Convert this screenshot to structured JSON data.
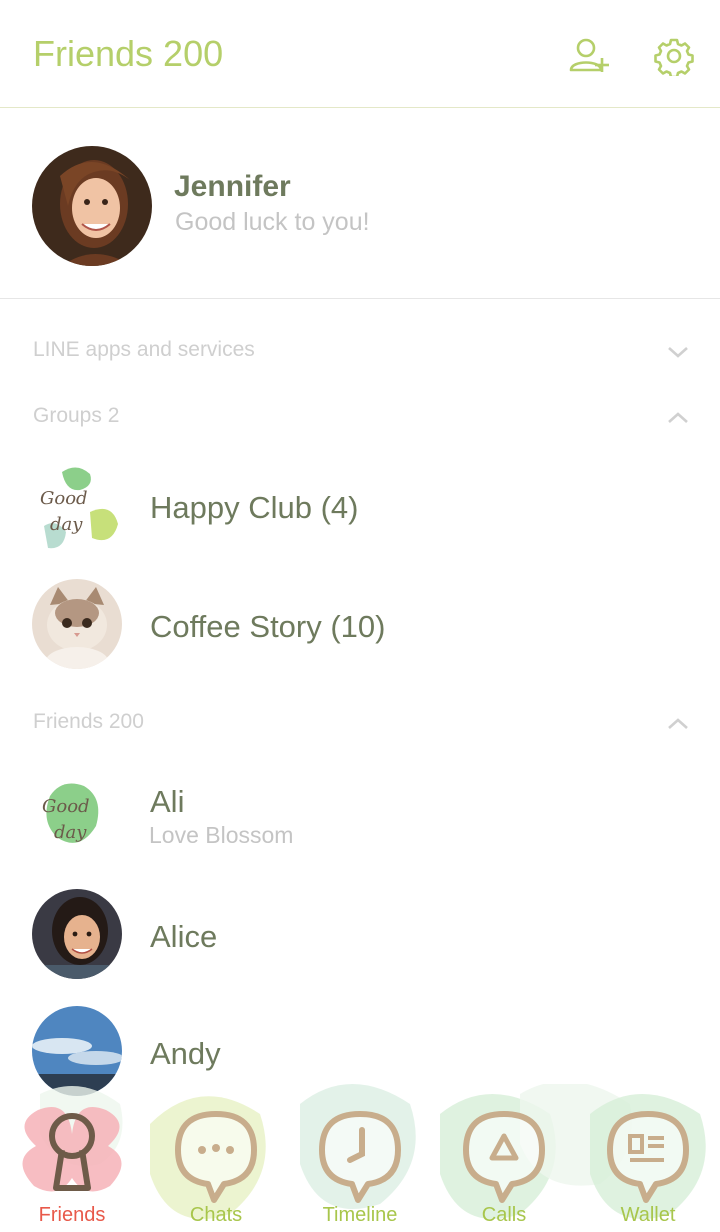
{
  "header": {
    "title": "Friends 200",
    "add_friend_icon": "add-friend-icon",
    "settings_icon": "gear-icon"
  },
  "profile": {
    "name": "Jennifer",
    "status": "Good luck to you!"
  },
  "sections": {
    "line_apps": {
      "label": "LINE apps and services",
      "expanded": false
    },
    "groups": {
      "label": "Groups 2",
      "expanded": true
    },
    "friends": {
      "label": "Friends 200",
      "expanded": true
    }
  },
  "groups": [
    {
      "name": "Happy Club (4)"
    },
    {
      "name": "Coffee Story (10)"
    }
  ],
  "friends": [
    {
      "name": "Ali",
      "status": "Love Blossom"
    },
    {
      "name": "Alice"
    },
    {
      "name": "Andy"
    }
  ],
  "tabs": [
    {
      "label": "Friends",
      "icon": "keyhole-icon",
      "active": true
    },
    {
      "label": "Chats",
      "icon": "chat-bubble-icon",
      "active": false
    },
    {
      "label": "Timeline",
      "icon": "clock-icon",
      "active": false
    },
    {
      "label": "Calls",
      "icon": "phone-triangle-icon",
      "active": false
    },
    {
      "label": "Wallet",
      "icon": "wallet-icon",
      "active": false
    }
  ],
  "colors": {
    "accent_green": "#b5cf6a",
    "name_text": "#6e7a5d",
    "active_tab": "#e8594a",
    "icon_brown": "#c8ad8c"
  }
}
